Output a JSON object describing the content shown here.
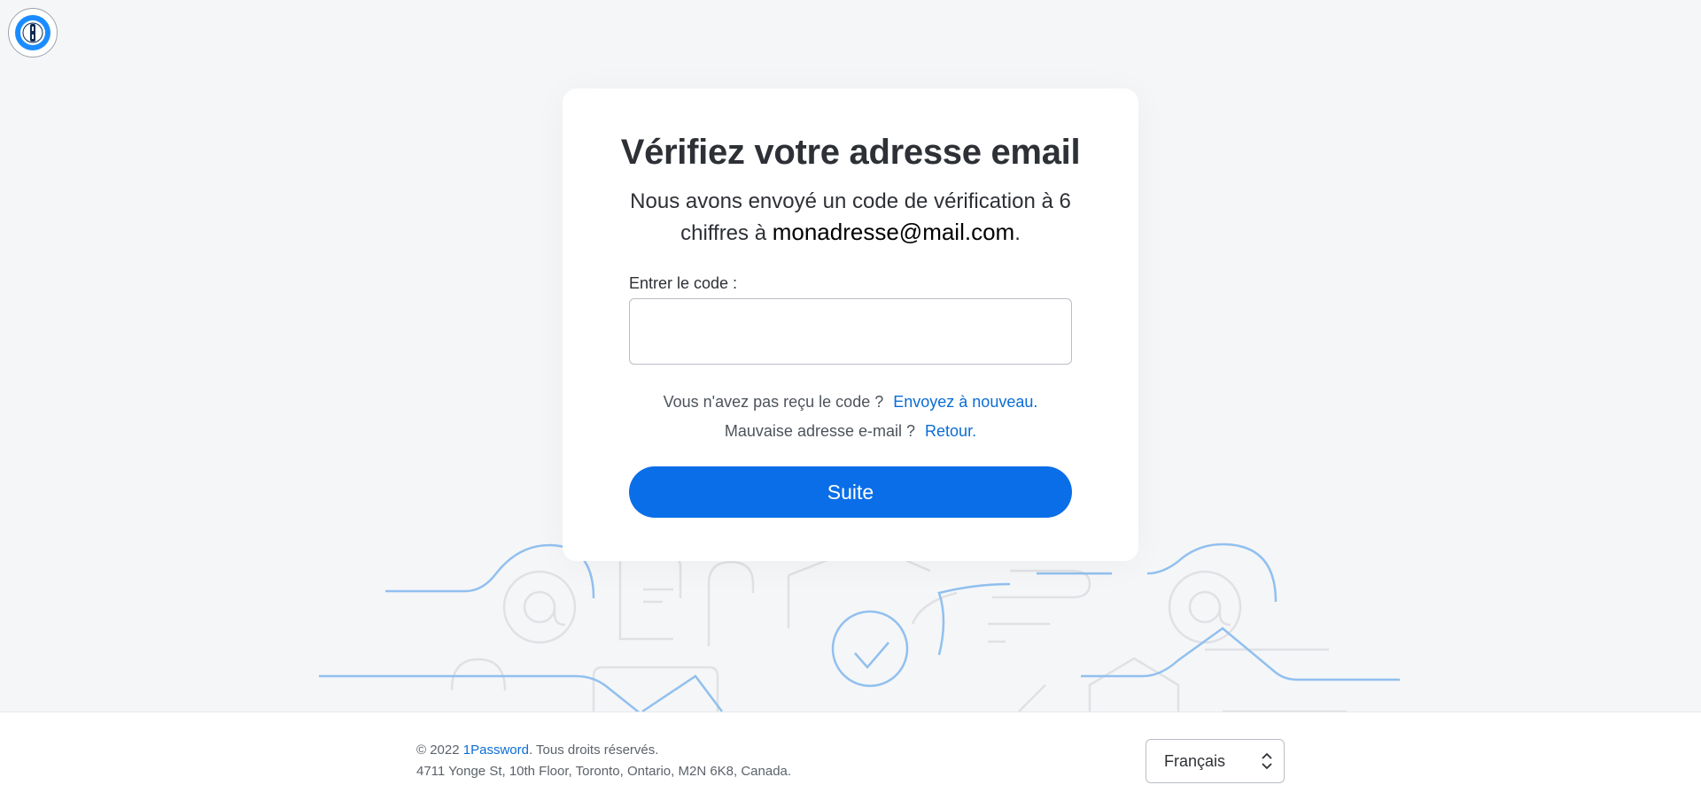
{
  "brand": {
    "logo_icon": "1password-keyhole-icon",
    "accent_color": "#0a6ee8",
    "link_color": "#0a6cd7"
  },
  "card": {
    "title": "Vérifiez votre adresse email",
    "subtitle_prefix": "Nous avons envoyé un code de vérification à 6 chiffres à ",
    "email": "monadresse@mail.com",
    "subtitle_suffix": ".",
    "code_label": "Entrer le code :",
    "code_value": "",
    "resend_question": "Vous n'avez pas reçu le code ?",
    "resend_link": "Envoyez à nouveau.",
    "wrong_email_question": "Mauvaise adresse e-mail ?",
    "back_link": "Retour.",
    "submit_label": "Suite"
  },
  "footer": {
    "copyright_prefix": "© 2022 ",
    "company_link": "1Password",
    "rights": ". Tous droits réservés.",
    "address": "4711 Yonge St, 10th Floor, Toronto, Ontario, M2N 6K8, Canada.",
    "language_selected": "Français"
  }
}
